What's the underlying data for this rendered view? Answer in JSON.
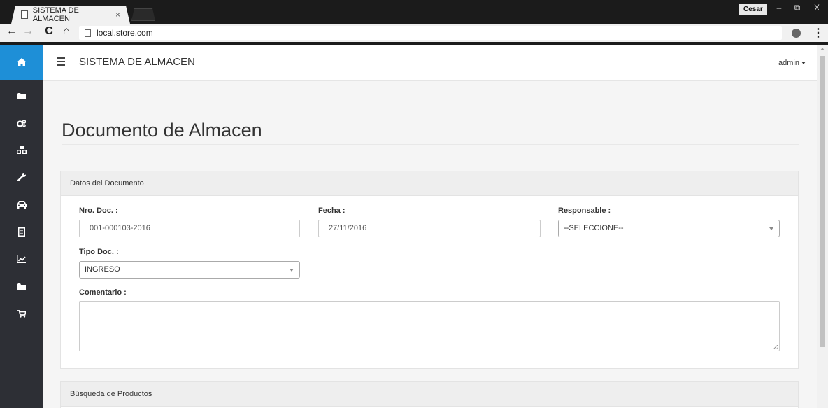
{
  "browser": {
    "tab_title": "SISTEMA DE ALMACEN",
    "tab_close": "×",
    "url": "local.store.com",
    "window_user": "Cesar",
    "window_minimize": "–",
    "window_restore": "⧉",
    "window_close": "X",
    "back_icon": "←",
    "forward_icon": "→",
    "reload_icon": "C",
    "home_icon": "⌂",
    "menu_icon": "⋮"
  },
  "sidebar": {
    "items": [
      {
        "icon": "home-icon"
      },
      {
        "icon": "folder-icon"
      },
      {
        "icon": "gears-icon"
      },
      {
        "icon": "cubes-icon"
      },
      {
        "icon": "wrench-icon"
      },
      {
        "icon": "car-icon"
      },
      {
        "icon": "list-doc-icon"
      },
      {
        "icon": "line-chart-icon"
      },
      {
        "icon": "folder-icon"
      },
      {
        "icon": "cart-icon"
      }
    ],
    "active_color": "#1e8fd7",
    "bg_color": "#2d2f35"
  },
  "header": {
    "app_title": "SISTEMA DE ALMACEN",
    "user_menu": "admin"
  },
  "main": {
    "page_title": "Documento de Almacen",
    "panel_document": {
      "heading": "Datos del Documento",
      "fields": {
        "nro_doc": {
          "label": "Nro. Doc. :",
          "value": "001-000103-2016"
        },
        "fecha": {
          "label": "Fecha :",
          "value": "27/11/2016"
        },
        "responsable": {
          "label": "Responsable :",
          "value": "--SELECCIONE--"
        },
        "tipo_doc": {
          "label": "Tipo Doc. :",
          "value": "INGRESO"
        },
        "comentario": {
          "label": "Comentario :",
          "value": ""
        }
      }
    },
    "panel_products": {
      "heading": "Búsqueda de Productos"
    }
  }
}
